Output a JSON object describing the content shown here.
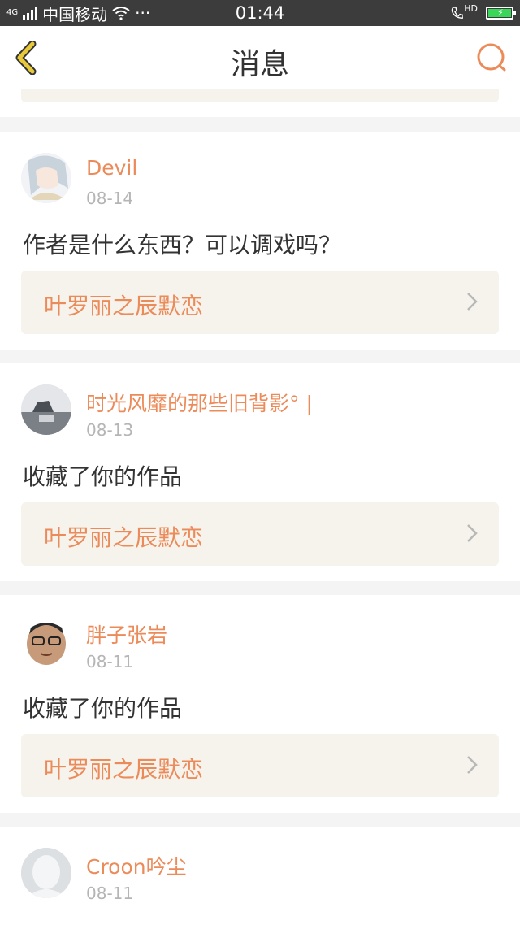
{
  "status_bar": {
    "network": "4G",
    "carrier": "中国移动",
    "more": "···",
    "time": "01:44",
    "hd": "HD"
  },
  "header": {
    "title": "消息"
  },
  "colors": {
    "accent": "#ec8b5a",
    "back_icon": "#e8c93a",
    "card_box": "#f5f3ec"
  },
  "messages": [
    {
      "username": "Devil",
      "date": "08-14",
      "content": "作者是什么东西？可以调戏吗？",
      "work_title": "叶罗丽之辰默恋"
    },
    {
      "username": "时光风靡的那些旧背影° |",
      "date": "08-13",
      "content": "收藏了你的作品",
      "work_title": "叶罗丽之辰默恋"
    },
    {
      "username": "胖子张岩",
      "date": "08-11",
      "content": "收藏了你的作品",
      "work_title": "叶罗丽之辰默恋"
    },
    {
      "username": "Croon吟尘",
      "date": "08-11"
    }
  ]
}
